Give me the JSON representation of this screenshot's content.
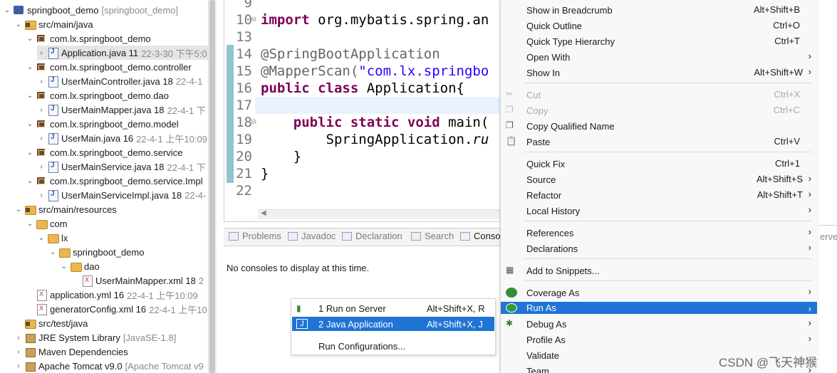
{
  "explorer": {
    "items": [
      {
        "label": "springboot_demo",
        "deco": "[springboot_demo]",
        "icon": "project-icon",
        "toggle": "⌄"
      },
      {
        "label": "src/main/java",
        "deco": "",
        "icon": "source-folder-icon",
        "toggle": "⌄"
      },
      {
        "label": "com.lx.springboot_demo",
        "deco": "",
        "icon": "package-icon",
        "toggle": "⌄"
      },
      {
        "label": "Application.java 11",
        "deco": "22-3-30 下午5:0",
        "icon": "java-file-icon",
        "toggle": "›"
      },
      {
        "label": "com.lx.springboot_demo.controller",
        "deco": "",
        "icon": "package-icon",
        "toggle": "⌄"
      },
      {
        "label": "UserMainController.java 18",
        "deco": "22-4-1",
        "icon": "java-file-icon",
        "toggle": "›"
      },
      {
        "label": "com.lx.springboot_demo.dao",
        "deco": "",
        "icon": "package-icon",
        "toggle": "⌄"
      },
      {
        "label": "UserMainMapper.java 18",
        "deco": "22-4-1 下",
        "icon": "java-file-icon",
        "toggle": "›"
      },
      {
        "label": "com.lx.springboot_demo.model",
        "deco": "",
        "icon": "package-icon",
        "toggle": "⌄"
      },
      {
        "label": "UserMain.java 16",
        "deco": "22-4-1 上午10:09",
        "icon": "java-file-icon",
        "toggle": "›"
      },
      {
        "label": "com.lx.springboot_demo.service",
        "deco": "",
        "icon": "package-icon",
        "toggle": "⌄"
      },
      {
        "label": "UserMainService.java 18",
        "deco": "22-4-1 下",
        "icon": "java-file-icon",
        "toggle": "›"
      },
      {
        "label": "com.lx.springboot_demo.service.Impl",
        "deco": "",
        "icon": "package-icon",
        "toggle": "⌄"
      },
      {
        "label": "UserMainServiceImpl.java 18",
        "deco": "22-4-",
        "icon": "java-file-icon",
        "toggle": "›"
      },
      {
        "label": "src/main/resources",
        "deco": "",
        "icon": "source-folder-icon",
        "toggle": "⌄"
      },
      {
        "label": "com",
        "deco": "",
        "icon": "folder-icon",
        "toggle": "⌄"
      },
      {
        "label": "lx",
        "deco": "",
        "icon": "folder-icon",
        "toggle": "⌄"
      },
      {
        "label": "springboot_demo",
        "deco": "",
        "icon": "folder-icon",
        "toggle": "⌄"
      },
      {
        "label": "dao",
        "deco": "",
        "icon": "folder-icon",
        "toggle": "⌄"
      },
      {
        "label": "UserMainMapper.xml 18",
        "deco": "2",
        "icon": "xml-file-icon",
        "toggle": ""
      },
      {
        "label": "application.yml 16",
        "deco": "22-4-1 上午10:09",
        "icon": "yml-file-icon",
        "toggle": ""
      },
      {
        "label": "generatorConfig.xml 16",
        "deco": "22-4-1 上午10",
        "icon": "xml-file-icon",
        "toggle": ""
      },
      {
        "label": "src/test/java",
        "deco": "",
        "icon": "source-folder-icon",
        "toggle": ""
      },
      {
        "label": "JRE System Library",
        "deco": "[JavaSE-1.8]",
        "icon": "library-icon",
        "toggle": "›"
      },
      {
        "label": "Maven Dependencies",
        "deco": "",
        "icon": "library-icon",
        "toggle": "›"
      },
      {
        "label": "Apache Tomcat v9.0",
        "deco": "[Apache Tomcat v9",
        "icon": "library-icon",
        "toggle": "›"
      }
    ]
  },
  "editor": {
    "line_numbers": [
      "9",
      "10",
      "13",
      "14",
      "15",
      "16",
      "17",
      "18",
      "19",
      "20",
      "21",
      "22"
    ],
    "line10": {
      "kw": "import",
      "rest": " org.mybatis.spring.an"
    },
    "line14": "@SpringBootApplication",
    "line15": {
      "ann": "@MapperScan(",
      "str": "\"com.lx.springbo"
    },
    "line16": {
      "kw": "public class",
      "rest": " Application{"
    },
    "line18": {
      "indent": "    ",
      "kw": "public static void",
      "rest": " main("
    },
    "line19": {
      "indent": "        ",
      "plain": "SpringApplication.",
      "italic": "ru"
    },
    "line20": "    }",
    "line21": "}"
  },
  "views": {
    "tabs": [
      {
        "label": "Problems",
        "icon": "problems-icon",
        "active": false
      },
      {
        "label": "Javadoc",
        "icon": "javadoc-icon",
        "active": false
      },
      {
        "label": "Declaration",
        "icon": "declaration-icon",
        "active": false
      },
      {
        "label": "Search",
        "icon": "search-icon",
        "active": false
      },
      {
        "label": "Conso",
        "icon": "console-icon",
        "active": true
      }
    ],
    "console_message": "No consoles to display at this time."
  },
  "run_as_submenu": {
    "items": [
      {
        "label": "1 Run on Server",
        "shortcut": "Alt+Shift+X, R",
        "icon": "server-run-icon"
      },
      {
        "label": "2 Java Application",
        "shortcut": "Alt+Shift+X, J",
        "icon": "java-app-icon"
      },
      {
        "label": "Run Configurations...",
        "shortcut": "",
        "icon": ""
      }
    ],
    "selected_index": 1
  },
  "context_menu": {
    "groups": [
      [
        {
          "label": "Show in Breadcrumb",
          "shortcut": "Alt+Shift+B",
          "submenu": false,
          "disabled": false,
          "icon": ""
        },
        {
          "label": "Quick Outline",
          "shortcut": "Ctrl+O",
          "submenu": false,
          "disabled": false,
          "icon": ""
        },
        {
          "label": "Quick Type Hierarchy",
          "shortcut": "Ctrl+T",
          "submenu": false,
          "disabled": false,
          "icon": ""
        },
        {
          "label": "Open With",
          "shortcut": "",
          "submenu": true,
          "disabled": false,
          "icon": ""
        },
        {
          "label": "Show In",
          "shortcut": "Alt+Shift+W",
          "submenu": true,
          "disabled": false,
          "icon": ""
        }
      ],
      [
        {
          "label": "Cut",
          "shortcut": "Ctrl+X",
          "submenu": false,
          "disabled": true,
          "icon": "scissors-icon"
        },
        {
          "label": "Copy",
          "shortcut": "Ctrl+C",
          "submenu": false,
          "disabled": true,
          "icon": "copy-icon"
        },
        {
          "label": "Copy Qualified Name",
          "shortcut": "",
          "submenu": false,
          "disabled": false,
          "icon": "copy-qualified-icon"
        },
        {
          "label": "Paste",
          "shortcut": "Ctrl+V",
          "submenu": false,
          "disabled": false,
          "icon": "paste-icon"
        }
      ],
      [
        {
          "label": "Quick Fix",
          "shortcut": "Ctrl+1",
          "submenu": false,
          "disabled": false,
          "icon": ""
        },
        {
          "label": "Source",
          "shortcut": "Alt+Shift+S",
          "submenu": true,
          "disabled": false,
          "icon": ""
        },
        {
          "label": "Refactor",
          "shortcut": "Alt+Shift+T",
          "submenu": true,
          "disabled": false,
          "icon": ""
        },
        {
          "label": "Local History",
          "shortcut": "",
          "submenu": true,
          "disabled": false,
          "icon": ""
        }
      ],
      [
        {
          "label": "References",
          "shortcut": "",
          "submenu": true,
          "disabled": false,
          "icon": ""
        },
        {
          "label": "Declarations",
          "shortcut": "",
          "submenu": true,
          "disabled": false,
          "icon": ""
        }
      ],
      [
        {
          "label": "Add to Snippets...",
          "shortcut": "",
          "submenu": false,
          "disabled": false,
          "icon": "snippets-icon"
        }
      ],
      [
        {
          "label": "Coverage As",
          "shortcut": "",
          "submenu": true,
          "disabled": false,
          "icon": "coverage-icon"
        },
        {
          "label": "Run As",
          "shortcut": "",
          "submenu": true,
          "disabled": false,
          "icon": "run-icon",
          "highlighted": true
        },
        {
          "label": "Debug As",
          "shortcut": "",
          "submenu": true,
          "disabled": false,
          "icon": "debug-icon"
        },
        {
          "label": "Profile As",
          "shortcut": "",
          "submenu": true,
          "disabled": false,
          "icon": ""
        },
        {
          "label": "Validate",
          "shortcut": "",
          "submenu": false,
          "disabled": false,
          "icon": ""
        },
        {
          "label": "Team",
          "shortcut": "",
          "submenu": true,
          "disabled": false,
          "icon": ""
        }
      ]
    ]
  },
  "right_strip_label": "erve",
  "watermark": "CSDN @飞天神猴",
  "colors": {
    "selection": "#1f74d6",
    "keyword": "#7f0055",
    "string": "#2a00ff",
    "annotation": "#646464"
  }
}
